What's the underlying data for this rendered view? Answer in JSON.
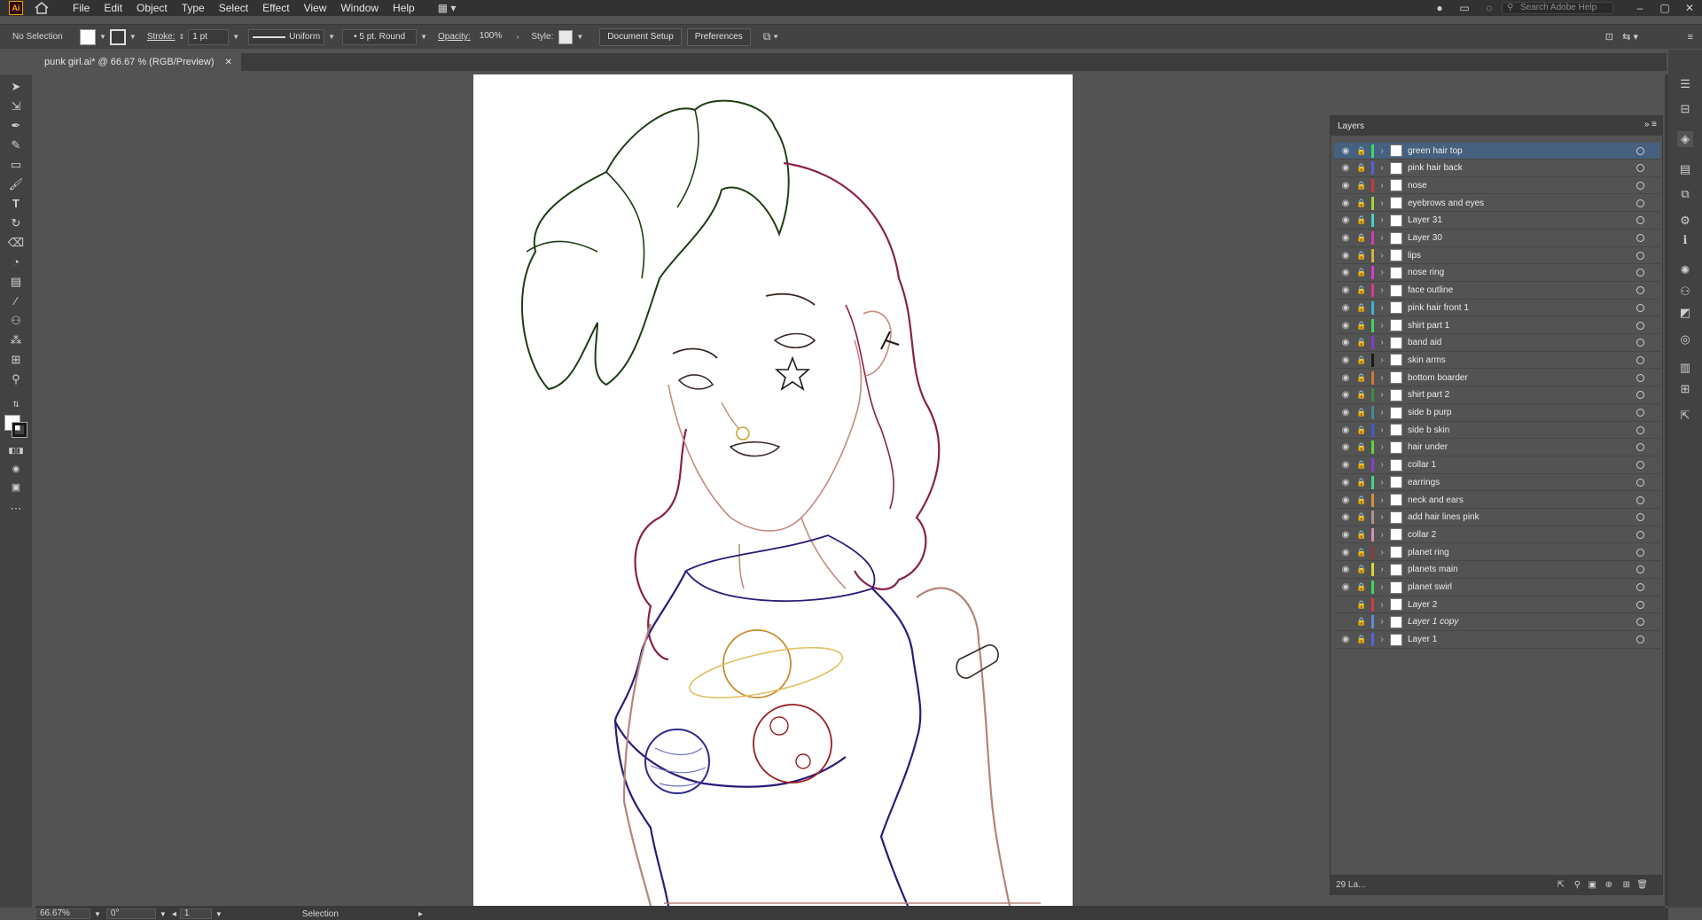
{
  "app": {
    "logo": "Ai"
  },
  "menu": [
    "File",
    "Edit",
    "Object",
    "Type",
    "Select",
    "Effect",
    "View",
    "Window",
    "Help"
  ],
  "search": {
    "placeholder": "Search Adobe Help"
  },
  "control": {
    "selection": "No Selection",
    "stroke_label": "Stroke:",
    "stroke_value": "1 pt",
    "profile": "Uniform",
    "brush": "5 pt. Round",
    "opacity_label": "Opacity:",
    "opacity_value": "100%",
    "style_label": "Style:",
    "document_setup": "Document Setup",
    "preferences": "Preferences"
  },
  "document": {
    "tab_title": "punk girl.ai* @ 66.67 % (RGB/Preview)"
  },
  "layers_panel": {
    "title": "Layers",
    "count_label": "29 La...",
    "layers": [
      {
        "name": "green hair top",
        "color": "#3bdd5b",
        "selected": true,
        "visible": true
      },
      {
        "name": "pink hair back",
        "color": "#4f64d6",
        "selected": false,
        "visible": true
      },
      {
        "name": "nose",
        "color": "#c83a3a",
        "selected": false,
        "visible": true
      },
      {
        "name": "eyebrows and eyes",
        "color": "#9fd63b",
        "selected": false,
        "visible": true
      },
      {
        "name": "Layer 31",
        "color": "#3bd6c8",
        "selected": false,
        "visible": true
      },
      {
        "name": "Layer 30",
        "color": "#d63bb5",
        "selected": false,
        "visible": true
      },
      {
        "name": "lips",
        "color": "#d6b03b",
        "selected": false,
        "visible": true
      },
      {
        "name": "nose ring",
        "color": "#d63bd6",
        "selected": false,
        "visible": true
      },
      {
        "name": "face outline",
        "color": "#d63b8f",
        "selected": false,
        "visible": true
      },
      {
        "name": "pink hair front 1",
        "color": "#3bb5d6",
        "selected": false,
        "visible": true
      },
      {
        "name": "shirt part 1",
        "color": "#3bd65b",
        "selected": false,
        "visible": true
      },
      {
        "name": "band aid",
        "color": "#7f3bd6",
        "selected": false,
        "visible": true
      },
      {
        "name": "skin arms",
        "color": "#1a1a1a",
        "selected": false,
        "visible": true
      },
      {
        "name": "bottom boarder",
        "color": "#d6743b",
        "selected": false,
        "visible": true
      },
      {
        "name": "shirt part 2",
        "color": "#3b8f3b",
        "selected": false,
        "visible": true
      },
      {
        "name": "side b purp",
        "color": "#3b8f8f",
        "selected": false,
        "visible": true
      },
      {
        "name": "side b skin",
        "color": "#3b5bd6",
        "selected": false,
        "visible": true
      },
      {
        "name": "hair under",
        "color": "#5bd63b",
        "selected": false,
        "visible": true
      },
      {
        "name": "collar 1",
        "color": "#8f3bd6",
        "selected": false,
        "visible": true
      },
      {
        "name": "earrings",
        "color": "#3bd68f",
        "selected": false,
        "visible": true
      },
      {
        "name": "neck and ears",
        "color": "#d68f3b",
        "selected": false,
        "visible": true
      },
      {
        "name": "add hair lines pink",
        "color": "#b58f8f",
        "selected": false,
        "visible": true
      },
      {
        "name": "collar 2",
        "color": "#d68fb5",
        "selected": false,
        "visible": true
      },
      {
        "name": "planet ring",
        "color": "#8f3b3b",
        "selected": false,
        "visible": true
      },
      {
        "name": "planets main",
        "color": "#d6d63b",
        "selected": false,
        "visible": true
      },
      {
        "name": "planet swirl",
        "color": "#3bd65b",
        "selected": false,
        "visible": true
      },
      {
        "name": "Layer 2",
        "color": "#d63b3b",
        "selected": false,
        "visible": false
      },
      {
        "name": "Layer 1 copy",
        "color": "#5b8fd6",
        "selected": false,
        "visible": false,
        "italic": true
      },
      {
        "name": "Layer 1",
        "color": "#4f64d6",
        "selected": false,
        "visible": true
      }
    ]
  },
  "status": {
    "zoom": "66.67%",
    "rotation": "0°",
    "artboard": "1",
    "tool": "Selection"
  },
  "colors": {
    "ui_dark": "#323232",
    "panel": "#535353",
    "selected_row": "#46607f",
    "hair_green": "#1f3d14",
    "hair_pink": "#8a1f4f",
    "skin_line": "#b5857a",
    "shirt_purple": "#2e1a78"
  }
}
